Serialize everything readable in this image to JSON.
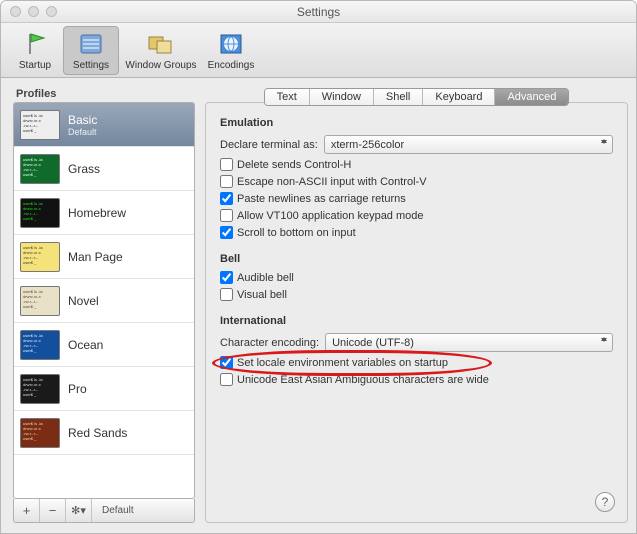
{
  "window": {
    "title": "Settings"
  },
  "toolbar": {
    "items": [
      {
        "label": "Startup"
      },
      {
        "label": "Settings"
      },
      {
        "label": "Window Groups"
      },
      {
        "label": "Encodings"
      }
    ]
  },
  "sidebar": {
    "header": "Profiles",
    "profiles": [
      {
        "name": "Basic",
        "sub": "Default",
        "bg": "#eeeeee",
        "fg": "#333333"
      },
      {
        "name": "Grass",
        "bg": "#0f6a2b",
        "fg": "#e7ffe1"
      },
      {
        "name": "Homebrew",
        "bg": "#111111",
        "fg": "#1ae21a"
      },
      {
        "name": "Man Page",
        "bg": "#f5e27a",
        "fg": "#3b3b3b"
      },
      {
        "name": "Novel",
        "bg": "#e9e0c8",
        "fg": "#5a4a2a"
      },
      {
        "name": "Ocean",
        "bg": "#134f9c",
        "fg": "#dfe9ff"
      },
      {
        "name": "Pro",
        "bg": "#1a1a1a",
        "fg": "#dddddd"
      },
      {
        "name": "Red Sands",
        "bg": "#7a2c14",
        "fg": "#f3d7a7"
      }
    ],
    "footer": {
      "add": "+",
      "remove": "−",
      "gear": "✻▾",
      "default": "Default"
    }
  },
  "tabs": [
    "Text",
    "Window",
    "Shell",
    "Keyboard",
    "Advanced"
  ],
  "emulation": {
    "heading": "Emulation",
    "declare_label": "Declare terminal as:",
    "declare_value": "xterm-256color",
    "opts": {
      "delete_ctrl_h": "Delete sends Control-H",
      "escape_nonascii": "Escape non-ASCII input with Control-V",
      "paste_newlines": "Paste newlines as carriage returns",
      "vt100_keypad": "Allow VT100 application keypad mode",
      "scroll_bottom": "Scroll to bottom on input"
    }
  },
  "bell": {
    "heading": "Bell",
    "audible": "Audible bell",
    "visual": "Visual bell"
  },
  "intl": {
    "heading": "International",
    "encoding_label": "Character encoding:",
    "encoding_value": "Unicode (UTF-8)",
    "set_locale": "Set locale environment variables on startup",
    "east_asian": "Unicode East Asian Ambiguous characters are wide"
  },
  "help": "?"
}
